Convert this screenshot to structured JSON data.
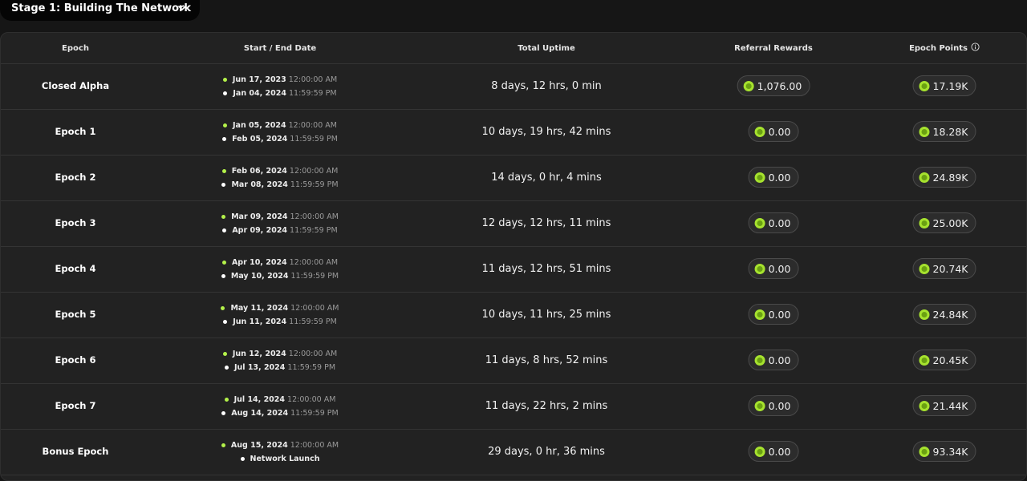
{
  "stage": {
    "label": "Stage 1: Building The Network"
  },
  "columns": {
    "epoch": "Epoch",
    "dates": "Start / End Date",
    "uptime": "Total Uptime",
    "referral": "Referral Rewards",
    "points": "Epoch Points"
  },
  "rows": [
    {
      "epoch": "Closed Alpha",
      "start_date": "Jun 17, 2023",
      "start_time": "12:00:00 AM",
      "end_date": "Jan 04, 2024",
      "end_time": "11:59:59 PM",
      "uptime": "8 days, 12 hrs, 0 min",
      "referral": "1,076.00",
      "points": "17.19K"
    },
    {
      "epoch": "Epoch 1",
      "start_date": "Jan 05, 2024",
      "start_time": "12:00:00 AM",
      "end_date": "Feb 05, 2024",
      "end_time": "11:59:59 PM",
      "uptime": "10 days, 19 hrs, 42 mins",
      "referral": "0.00",
      "points": "18.28K"
    },
    {
      "epoch": "Epoch 2",
      "start_date": "Feb 06, 2024",
      "start_time": "12:00:00 AM",
      "end_date": "Mar 08, 2024",
      "end_time": "11:59:59 PM",
      "uptime": "14 days, 0 hr, 4 mins",
      "referral": "0.00",
      "points": "24.89K"
    },
    {
      "epoch": "Epoch 3",
      "start_date": "Mar 09, 2024",
      "start_time": "12:00:00 AM",
      "end_date": "Apr 09, 2024",
      "end_time": "11:59:59 PM",
      "uptime": "12 days, 12 hrs, 11 mins",
      "referral": "0.00",
      "points": "25.00K"
    },
    {
      "epoch": "Epoch 4",
      "start_date": "Apr 10, 2024",
      "start_time": "12:00:00 AM",
      "end_date": "May 10, 2024",
      "end_time": "11:59:59 PM",
      "uptime": "11 days, 12 hrs, 51 mins",
      "referral": "0.00",
      "points": "20.74K"
    },
    {
      "epoch": "Epoch 5",
      "start_date": "May 11, 2024",
      "start_time": "12:00:00 AM",
      "end_date": "Jun 11, 2024",
      "end_time": "11:59:59 PM",
      "uptime": "10 days, 11 hrs, 25 mins",
      "referral": "0.00",
      "points": "24.84K"
    },
    {
      "epoch": "Epoch 6",
      "start_date": "Jun 12, 2024",
      "start_time": "12:00:00 AM",
      "end_date": "Jul 13, 2024",
      "end_time": "11:59:59 PM",
      "uptime": "11 days, 8 hrs, 52 mins",
      "referral": "0.00",
      "points": "20.45K"
    },
    {
      "epoch": "Epoch 7",
      "start_date": "Jul 14, 2024",
      "start_time": "12:00:00 AM",
      "end_date": "Aug 14, 2024",
      "end_time": "11:59:59 PM",
      "uptime": "11 days, 22 hrs, 2 mins",
      "referral": "0.00",
      "points": "21.44K"
    },
    {
      "epoch": "Bonus Epoch",
      "start_date": "Aug 15, 2024",
      "start_time": "12:00:00 AM",
      "end_date": "Network Launch",
      "end_time": "",
      "uptime": "29 days, 0 hr, 36 mins",
      "referral": "0.00",
      "points": "93.34K"
    }
  ],
  "icons": {
    "dropdown": "chevron-down-icon",
    "info": "info-icon",
    "coin": "coin-icon",
    "start_marker": "green-dot-icon",
    "end_marker": "white-dot-icon"
  },
  "colors": {
    "accent_green": "#b4f24a",
    "background": "#161616",
    "panel": "#222222"
  }
}
